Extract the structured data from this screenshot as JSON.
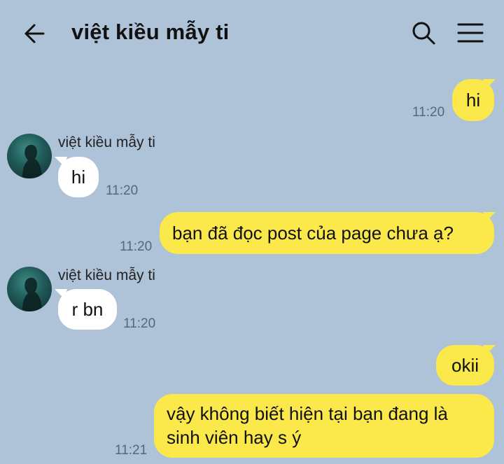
{
  "header": {
    "title": "việt kiều mẫy ti",
    "back_icon": "arrow-left-icon",
    "search_icon": "search-icon",
    "menu_icon": "hamburger-menu-icon"
  },
  "colors": {
    "background": "#aec2d8",
    "my_bubble": "#fbe84a",
    "their_bubble": "#ffffff",
    "timestamp": "#5a6773"
  },
  "messages": [
    {
      "from": "me",
      "text": "hi",
      "time": "11:20"
    },
    {
      "from": "them",
      "sender": "việt kiều mẫy ti",
      "text": "hi",
      "time": "11:20"
    },
    {
      "from": "me",
      "text": "bạn đã đọc post của page chưa ạ?",
      "time": "11:20"
    },
    {
      "from": "them",
      "sender": "việt kiều mẫy ti",
      "text": "r bn",
      "time": "11:20"
    },
    {
      "from": "me",
      "text": "okii",
      "time": ""
    },
    {
      "from": "me",
      "text": "vậy không biết hiện tại bạn đang là sinh viên hay s ý",
      "time": "11:21"
    }
  ]
}
